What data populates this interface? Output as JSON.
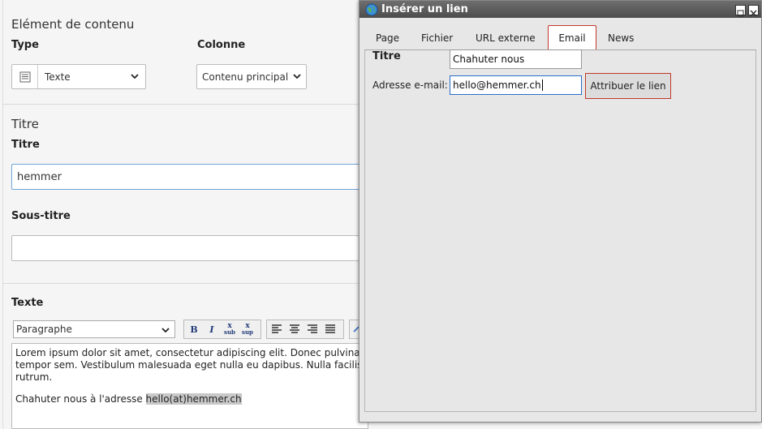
{
  "content_element": {
    "section_title": "Elément de contenu",
    "type_label": "Type",
    "type_value": "Texte",
    "column_label": "Colonne",
    "column_value": "Contenu principal"
  },
  "title_section": {
    "section_title": "Titre",
    "title_label": "Titre",
    "title_value": "hemmer",
    "subtitle_label": "Sous-titre",
    "subtitle_value": ""
  },
  "text_section": {
    "label": "Texte",
    "paragraph_format": "Paragraphe",
    "toolbar": {
      "bold": "B",
      "italic": "I",
      "subscript_main": "x",
      "subscript_sub": "sub",
      "superscript_main": "x",
      "superscript_sub": "sup"
    },
    "body_lines": [
      "Lorem ipsum dolor sit amet, consectetur adipiscing elit. Donec pulvinar",
      "tempor sem. Vestibulum malesuada eget nulla eu dapibus. Nulla facilisi.",
      "rutrum."
    ],
    "link_sentence_prefix": "Chahuter nous à l'adresse ",
    "link_sentence_highlight": "hello(at)hemmer.ch"
  },
  "dialog": {
    "title": "Insérer un lien",
    "tabs": [
      "Page",
      "Fichier",
      "URL externe",
      "Email",
      "News"
    ],
    "active_tab": "Email",
    "title_field_label": "Titre",
    "title_field_value": "Chahuter nous",
    "email_label": "Adresse e-mail:",
    "email_value": "hello@hemmer.ch",
    "submit_label": "Attribuer le lien"
  },
  "colors": {
    "dialog_title_bar": "#5a5a5a",
    "active_tab_border": "#c0392b",
    "input_focus": "#2a6bc9"
  }
}
